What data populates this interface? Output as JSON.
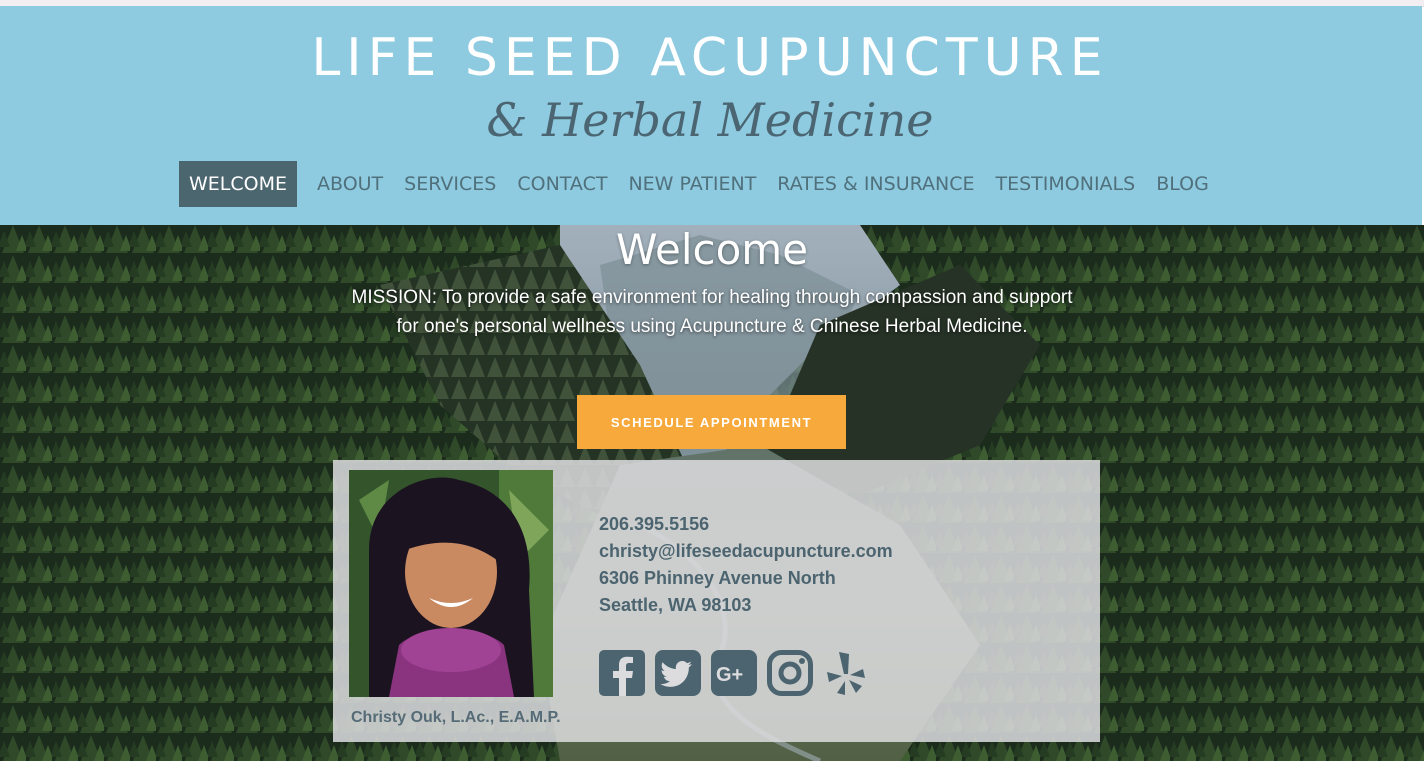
{
  "header": {
    "title": "LIFE SEED ACUPUNCTURE",
    "subtitle": "& Herbal Medicine",
    "background_color": "#8ecbe0"
  },
  "nav": {
    "items": [
      {
        "label": "WELCOME",
        "active": true
      },
      {
        "label": "ABOUT"
      },
      {
        "label": "SERVICES"
      },
      {
        "label": "CONTACT"
      },
      {
        "label": "NEW PATIENT"
      },
      {
        "label": "RATES & INSURANCE"
      },
      {
        "label": "TESTIMONIALS"
      },
      {
        "label": "BLOG"
      }
    ]
  },
  "hero": {
    "heading": "Welcome",
    "mission": "MISSION: To provide a safe environment for healing through compassion and support for one's personal wellness using Acupuncture & Chinese Herbal Medicine.",
    "cta_label": "SCHEDULE APPOINTMENT",
    "cta_color": "#f7a93b"
  },
  "profile": {
    "caption": "Christy Ouk, L.Ac., E.A.M.P.",
    "phone": "206.395.5156",
    "email": "christy@lifeseedacupuncture.com",
    "address_line1": "6306 Phinney Avenue North",
    "address_line2": "Seattle, WA 98103"
  },
  "social": {
    "icons": [
      "facebook-icon",
      "twitter-icon",
      "google-plus-icon",
      "instagram-icon",
      "yelp-icon"
    ],
    "icon_color": "#4c6470"
  }
}
